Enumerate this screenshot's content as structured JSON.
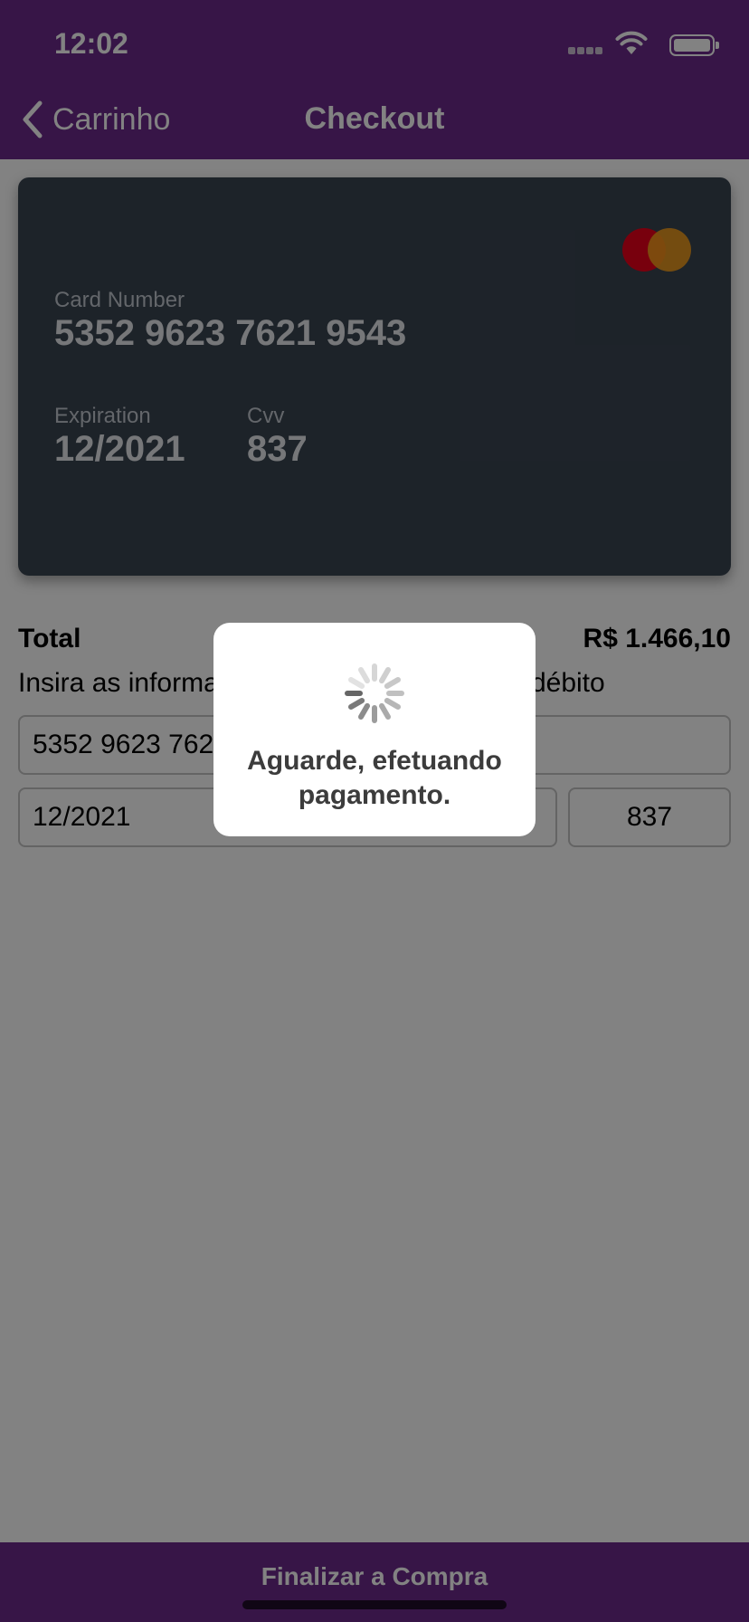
{
  "status_bar": {
    "time": "12:02"
  },
  "nav": {
    "back_label": "Carrinho",
    "title": "Checkout"
  },
  "card": {
    "number_label": "Card Number",
    "number": "5352 9623 7621 9543",
    "expiration_label": "Expiration",
    "expiration": "12/2021",
    "cvv_label": "Cvv",
    "cvv": "837"
  },
  "summary": {
    "total_label": "Total",
    "total_value": "R$ 1.466,10",
    "instruction": "Insira as informações do cartão de crédito/débito"
  },
  "form": {
    "card_number_value": "5352 9623 7621 9543",
    "expiration_value": "12/2021",
    "cvv_value": "837"
  },
  "loading": {
    "message": "Aguarde, efetuando pagamento."
  },
  "footer": {
    "finalize_label": "Finalizar a Compra"
  },
  "colors": {
    "brand": "#6c2a8c",
    "card_bg": "#3a4552",
    "overlay": "rgba(0,0,0,0.49)"
  }
}
